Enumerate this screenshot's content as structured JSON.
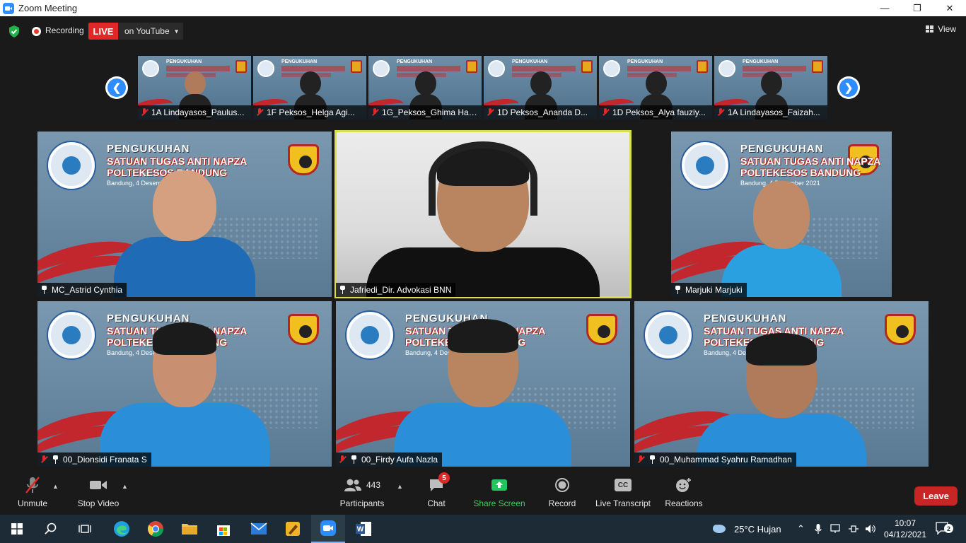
{
  "window": {
    "title": "Zoom Meeting",
    "controls": [
      "minimize",
      "maximize",
      "close"
    ]
  },
  "topbar": {
    "recording_label": "Recording",
    "live_label": "LIVE",
    "stream_label": "on YouTube",
    "view_label": "View"
  },
  "gallery_strip": {
    "participants": [
      {
        "name": "1A Lindayasos_Paulus...",
        "muted": true
      },
      {
        "name": "1F Peksos_Helga Agi...",
        "muted": true
      },
      {
        "name": "1G_Peksos_Ghima Hai...",
        "muted": true
      },
      {
        "name": "1D Peksos_Ananda D...",
        "muted": true
      },
      {
        "name": "1D Peksos_Alya fauziy...",
        "muted": true
      },
      {
        "name": "1A Lindayasos_Faizah...",
        "muted": true
      }
    ],
    "banner_title": "PENGUKUHAN"
  },
  "banner": {
    "title": "PENGUKUHAN",
    "line1": "SATUAN TUGAS ANTI NAPZA",
    "line2": "POLTEKESOS BANDUNG",
    "date": "Bandung, 4 Desember 2021"
  },
  "videos": [
    {
      "name": "MC_Astrid Cynthia",
      "muted": false,
      "active": false
    },
    {
      "name": "Jafriedi_Dir. Advokasi BNN",
      "muted": false,
      "active": true
    },
    {
      "name": "Marjuki Marjuki",
      "muted": false,
      "active": false
    },
    {
      "name": "00_Dionsidi Franata S",
      "muted": true,
      "active": false
    },
    {
      "name": "00_Firdy Aufa Nazla",
      "muted": true,
      "active": false
    },
    {
      "name": "00_Muhammad Syahru Ramadhan",
      "muted": true,
      "active": false
    }
  ],
  "toolbar": {
    "unmute": "Unmute",
    "stop_video": "Stop Video",
    "participants_count": "443",
    "participants": "Participants",
    "chat": "Chat",
    "chat_badge": "5",
    "share_screen": "Share Screen",
    "record": "Record",
    "live_transcript": "Live Transcript",
    "cc_label": "CC",
    "reactions": "Reactions",
    "leave": "Leave"
  },
  "taskbar": {
    "weather": "25°C  Hujan",
    "time": "10:07",
    "date": "04/12/2021",
    "notifications": "2"
  },
  "colors": {
    "accent": "#2d8cff",
    "live": "#e02828",
    "share": "#22c55e",
    "leave": "#c82525",
    "active_speaker": "#d7e04a"
  }
}
